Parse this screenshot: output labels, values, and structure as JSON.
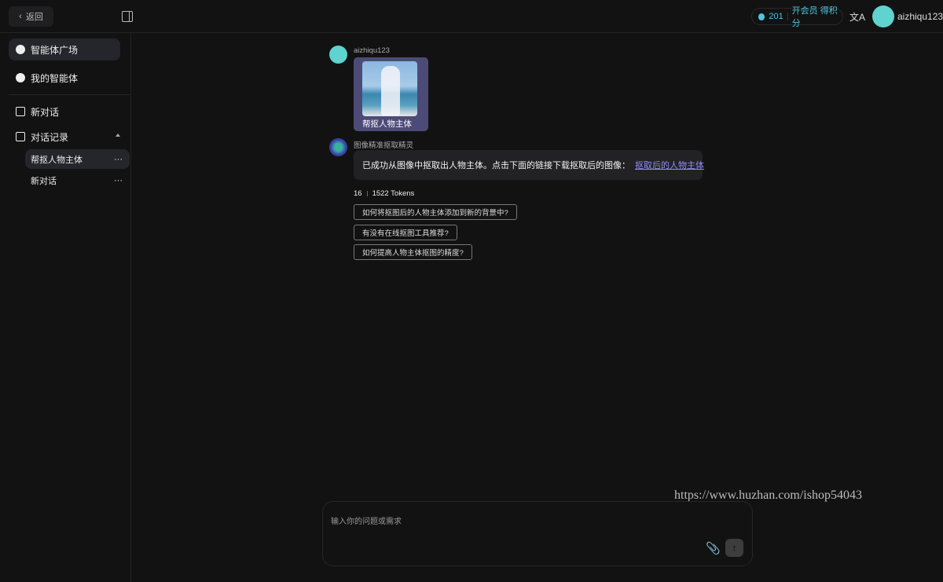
{
  "header": {
    "back_label": "返回",
    "points": "201",
    "vip_label": "开会员 得积分",
    "translate_icon": "文A",
    "username": "aizhiqu123"
  },
  "sidebar": {
    "nav": [
      {
        "label": "智能体广场",
        "icon": "compass-icon"
      },
      {
        "label": "我的智能体",
        "icon": "agent-icon"
      },
      {
        "label": "新对话",
        "icon": "edit-icon"
      },
      {
        "label": "对话记录",
        "icon": "clipboard-icon"
      }
    ],
    "history": [
      {
        "label": "帮抠人物主体",
        "more": "···"
      },
      {
        "label": "新对话",
        "more": "···"
      }
    ]
  },
  "chat": {
    "user_name": "aizhiqu123",
    "user_caption": "帮抠人物主体",
    "bot_name": "图像精准抠取精灵",
    "reply_text": "已成功从图像中抠取出人物主体。点击下面的链接下载抠取后的图像：",
    "reply_link": "抠取后的人物主体",
    "stats_time": "16",
    "stats_tokens": "1522 Tokens",
    "suggestions": [
      "如何将抠图后的人物主体添加到新的背景中?",
      "有没有在线抠图工具推荐?",
      "如何提高人物主体抠图的精度?"
    ]
  },
  "input": {
    "placeholder": "输入你的问题或需求",
    "send_icon": "↑"
  },
  "watermark": "https://www.huzhan.com/ishop54043",
  "colors": {
    "accent": "#4fc3e0",
    "link": "#8f8cf7",
    "user_card": "#4c4b78",
    "background": "#121212"
  }
}
